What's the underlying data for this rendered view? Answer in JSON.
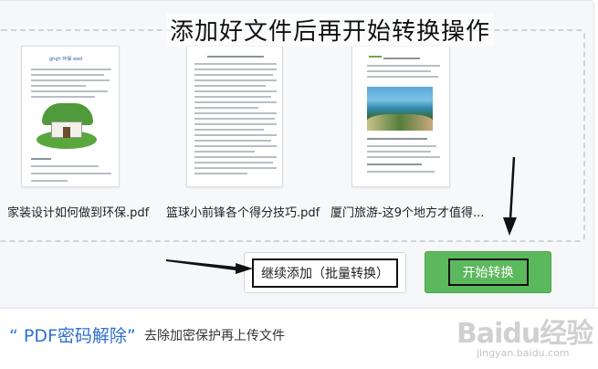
{
  "overlay": {
    "headline": "添加好文件后再开始转换操作"
  },
  "files": [
    {
      "name": "家装设计如何做到环保.pdf",
      "thumb_title": "ghgh 环保  wed"
    },
    {
      "name": "篮球小前锋各个得分技巧.pdf"
    },
    {
      "name": "厦门旅游-这9个地方才值得..."
    }
  ],
  "buttons": {
    "continue_add": "继续添加（批量转换）",
    "start_convert": "开始转换"
  },
  "footer": {
    "title": "“ PDF密码解除”",
    "description": "去除加密保护再上传文件"
  },
  "watermark": {
    "logo": "Baidu经验",
    "url": "jingyan.baidu.com"
  },
  "colors": {
    "start_button": "#5cb85c",
    "title_blue": "#2d6fcf",
    "panel_bg": "#f6f7f9"
  }
}
